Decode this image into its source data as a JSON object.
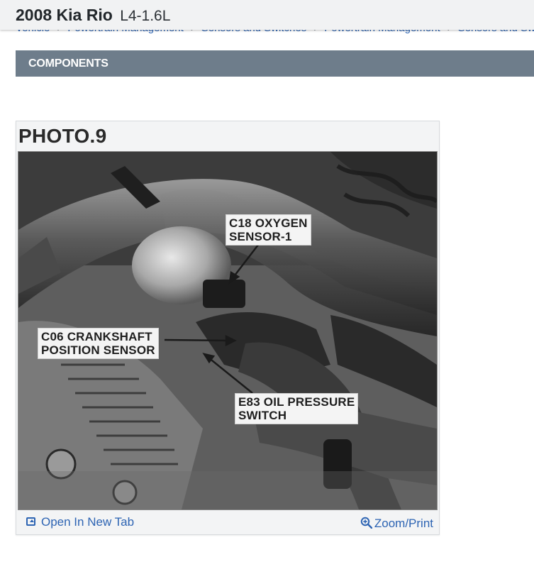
{
  "header": {
    "make_model": "2008 Kia Rio",
    "engine": "L4-1.6L"
  },
  "breadcrumb": [
    "Vehicle",
    "Powertrain Management",
    "Sensors and Switches",
    "Powertrain Management",
    "Sensors and Switches"
  ],
  "section": {
    "title": "COMPONENTS"
  },
  "figure": {
    "caption": "PHOTO.9",
    "callouts": {
      "oxygen": [
        "C18 OXYGEN",
        "SENSOR-1"
      ],
      "crankshaft": [
        "C06 CRANKSHAFT",
        "POSITION SENSOR"
      ],
      "oil": [
        "E83 OIL PRESSURE",
        "SWITCH"
      ]
    },
    "open_tab_label": "Open In New Tab",
    "zoom_label": "Zoom/Print"
  },
  "icons": {
    "open_tab": "open-in-new-tab-icon",
    "zoom": "zoom-magnifier-icon"
  },
  "colors": {
    "section_bar": "#6e7d8b",
    "link": "#2d64b3",
    "header_bg": "#f1f2f3"
  }
}
